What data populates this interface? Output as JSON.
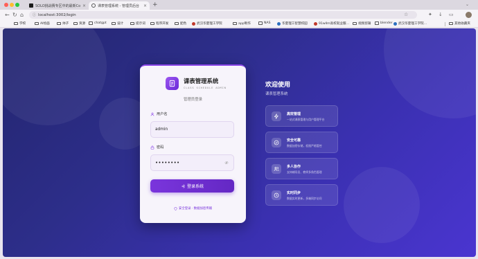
{
  "browser": {
    "tabs": [
      {
        "label": "SOLO挑战赛专区中的最新Code…"
      },
      {
        "label": "课表管理系统 - 管理员后台"
      }
    ],
    "new_tab_icon": "plus-icon",
    "url": "localhost:3002/login",
    "bookmarks": [
      {
        "label": "学校",
        "icon": "folder"
      },
      {
        "label": "AI绘画",
        "icon": "folder"
      },
      {
        "label": "帅子",
        "icon": "folder"
      },
      {
        "label": "资源",
        "icon": "folder"
      },
      {
        "label": "chatgpt",
        "icon": "folder"
      },
      {
        "label": "设计",
        "icon": "folder"
      },
      {
        "label": "提示词",
        "icon": "folder"
      },
      {
        "label": "程序开发",
        "icon": "folder"
      },
      {
        "label": "配色",
        "icon": "folder"
      },
      {
        "label": "武汉华夏理工学院",
        "icon": "globe"
      },
      {
        "label": "app制作",
        "icon": "folder"
      },
      {
        "label": "NAS",
        "icon": "folder"
      },
      {
        "label": "华夏理工智慧校园",
        "icon": "globe"
      },
      {
        "label": "91wllm高校就业服…",
        "icon": "globe"
      },
      {
        "label": "视频剪辑",
        "icon": "folder"
      },
      {
        "label": "blender",
        "icon": "folder"
      },
      {
        "label": "武汉华夏理工学院…",
        "icon": "globe"
      }
    ],
    "other_bookmarks": "其他收藏夹"
  },
  "login": {
    "title": "课表管理系统",
    "subtitle": "CLASS SCHEDULE ADMIN",
    "role": "管理员登录",
    "username_label": "用户名",
    "username_value": "admin",
    "password_label": "密码",
    "password_value": "••••••••",
    "submit_label": "登录系统",
    "secure_note": "安全登录 · 数据加密传输"
  },
  "info": {
    "welcome": "欢迎使用",
    "subtitle": "课表管理系统",
    "features": [
      {
        "title": "高效管理",
        "desc": "一站式课表管理与用户管理平台",
        "icon": "lightning-icon"
      },
      {
        "title": "安全可靠",
        "desc": "数据加密存储，权限严格管控",
        "icon": "shield-check-icon"
      },
      {
        "title": "多人协作",
        "desc": "支持辅导员、教师多角色管理",
        "icon": "users-icon"
      },
      {
        "title": "实时同步",
        "desc": "数据实时更新，多端同步访问",
        "icon": "clock-icon"
      }
    ]
  },
  "colors": {
    "accent": "#7a35dc",
    "background_start": "#23256e",
    "background_end": "#4a35d0"
  }
}
